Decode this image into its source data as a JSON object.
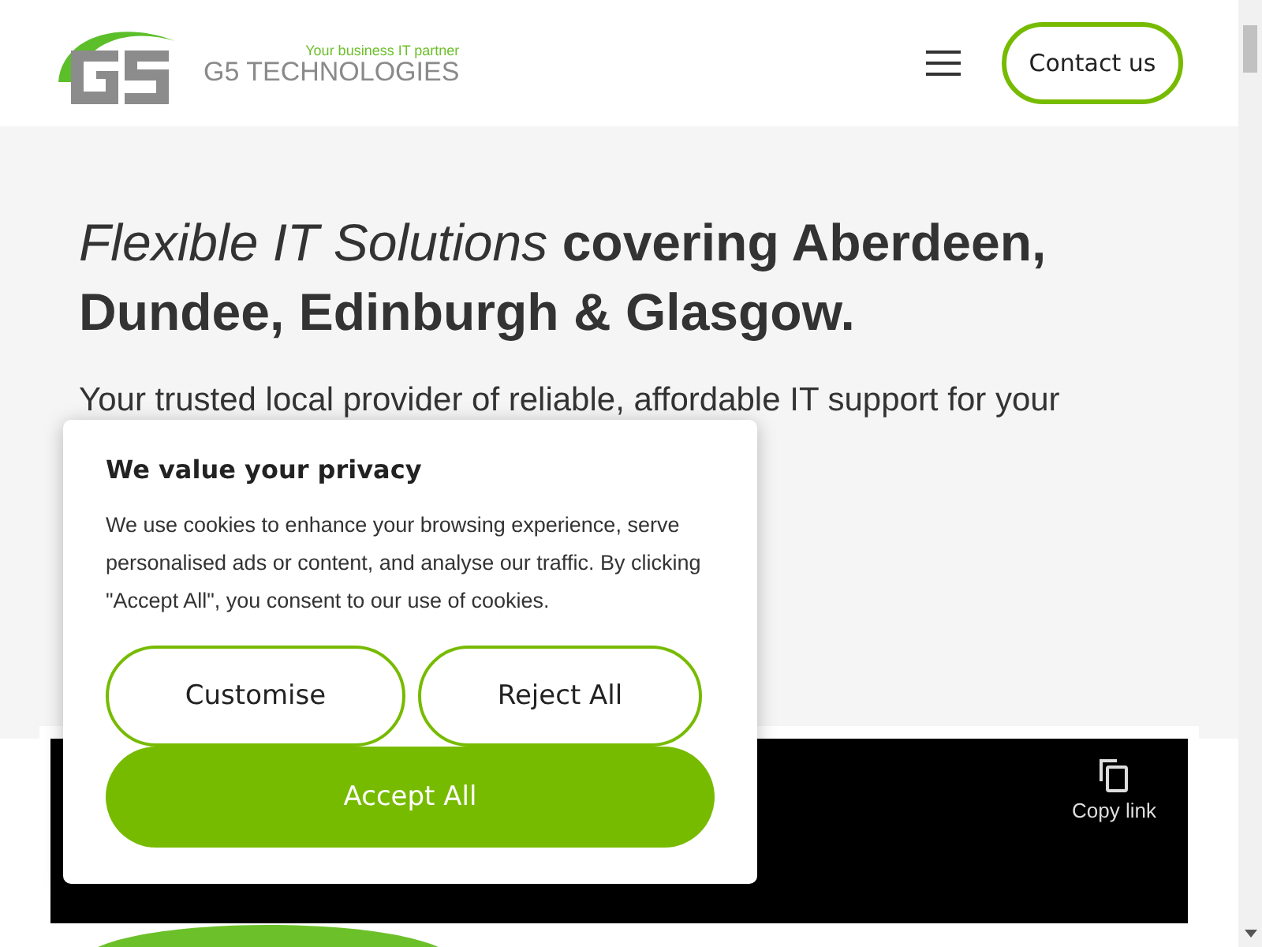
{
  "header": {
    "logo": {
      "tagline": "Your business IT partner",
      "name": "G5 TECHNOLOGIES"
    },
    "contact_button": "Contact us"
  },
  "hero": {
    "heading_italic": "Flexible IT Solutions",
    "heading_rest": "covering Aberdeen, Dundee, Edinburgh & Glasgow.",
    "subtitle": "Your trusted local provider of reliable, affordable IT support for your"
  },
  "video": {
    "copy_link": "Copy link"
  },
  "cookie_dialog": {
    "title": "We value your privacy",
    "text": "We use cookies to enhance your browsing experience, serve personalised ads or content, and analyse our traffic. By clicking \"Accept All\", you consent to our use of cookies.",
    "buttons": [
      {
        "label": "Customise",
        "kind": "outline"
      },
      {
        "label": "Reject All",
        "kind": "outline"
      },
      {
        "label": "Accept All",
        "kind": "primary"
      }
    ]
  }
}
